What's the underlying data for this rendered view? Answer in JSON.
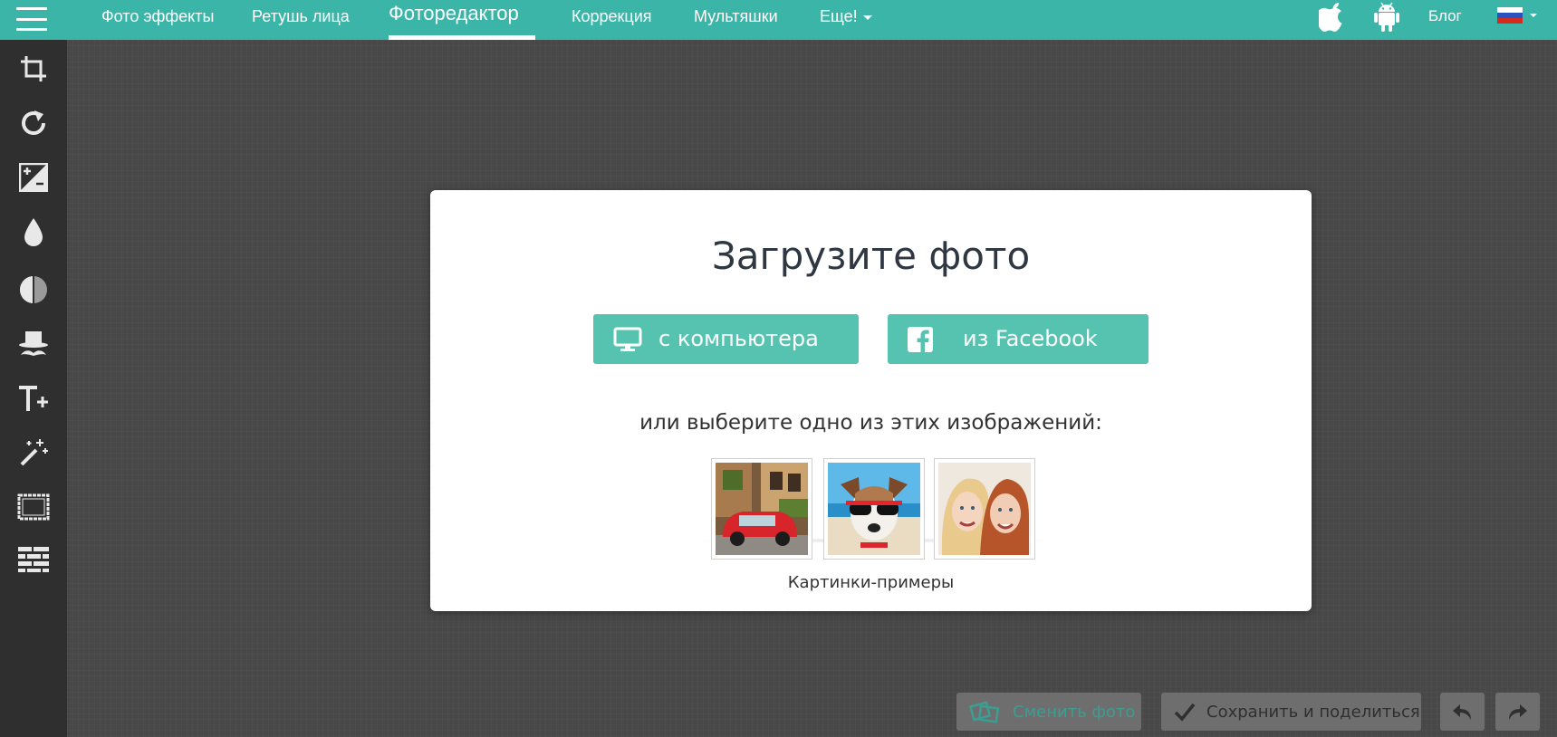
{
  "menu": {
    "label": "menu-icon"
  },
  "nav": {
    "items": [
      {
        "label": "Фото эффекты"
      },
      {
        "label": "Ретушь лица"
      },
      {
        "label": "Фоторедактор",
        "active": true
      },
      {
        "label": "Коррекция"
      },
      {
        "label": "Мультяшки"
      },
      {
        "label": "Еще!"
      }
    ],
    "blog": "Блог"
  },
  "icons": {
    "platforms": [
      "apple-icon",
      "android-icon"
    ],
    "language": "russia-flag-icon",
    "tools": [
      "crop-icon",
      "rotate-icon",
      "exposure-icon",
      "drop-icon",
      "contrast-icon",
      "hat-mustache-icon",
      "text-add-icon",
      "magic-wand-icon",
      "frame-icon",
      "texture-icon"
    ]
  },
  "dialog": {
    "title": "Загрузите фото",
    "computer_button": "с компьютера",
    "facebook_button": "из Facebook",
    "choose_text": "или выберите одно из этих изображений:",
    "samples": [
      "car-photo",
      "dog-photo",
      "friends-photo"
    ],
    "samples_caption": "Картинки-примеры"
  },
  "bottom": {
    "change_photo": "Сменить фото",
    "save_share": "Сохранить и поделиться"
  },
  "colors": {
    "accent": "#3cb5a9",
    "button": "#55c3b0",
    "sidebar": "#2f2f2f",
    "canvas": "#484848"
  }
}
